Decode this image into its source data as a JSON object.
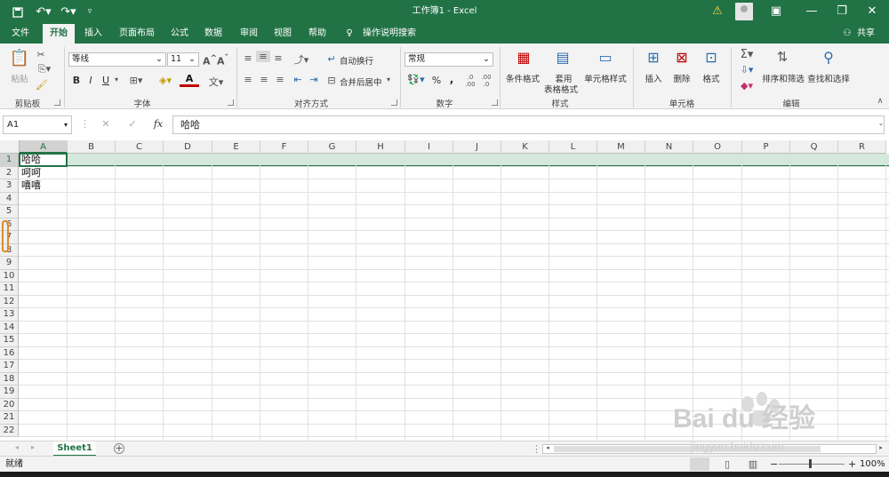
{
  "titlebar": {
    "title": "工作簿1  -  Excel",
    "save_icon": "save-icon",
    "undo_icon": "undo-icon",
    "redo_icon": "redo-icon"
  },
  "tabs": [
    {
      "label": "文件"
    },
    {
      "label": "开始"
    },
    {
      "label": "插入"
    },
    {
      "label": "页面布局"
    },
    {
      "label": "公式"
    },
    {
      "label": "数据"
    },
    {
      "label": "审阅"
    },
    {
      "label": "视图"
    },
    {
      "label": "帮助"
    },
    {
      "label": "操作说明搜索"
    }
  ],
  "share_label": "共享",
  "ribbon": {
    "clipboard": {
      "paste": "粘贴",
      "group": "剪贴板"
    },
    "font": {
      "name": "等线",
      "size": "11",
      "bold": "B",
      "italic": "I",
      "underline": "U",
      "group": "字体"
    },
    "alignment": {
      "wrap": "自动换行",
      "merge": "合并后居中",
      "group": "对齐方式"
    },
    "number": {
      "format": "常规",
      "percent": "%",
      "comma": ",",
      "group": "数字"
    },
    "styles": {
      "cond": "条件格式",
      "table1": "套用",
      "table2": "表格格式",
      "cell": "单元格样式",
      "group": "样式"
    },
    "cells": {
      "insert": "插入",
      "delete": "删除",
      "format": "格式",
      "group": "单元格"
    },
    "editing": {
      "sort": "排序和筛选",
      "find": "查找和选择",
      "group": "编辑"
    }
  },
  "formula_bar": {
    "namebox": "A1",
    "fx": "fx",
    "content": "哈哈"
  },
  "columns": [
    "A",
    "B",
    "C",
    "D",
    "E",
    "F",
    "G",
    "H",
    "I",
    "J",
    "K",
    "L",
    "M",
    "N",
    "O",
    "P",
    "Q",
    "R"
  ],
  "rows": [
    "1",
    "2",
    "3",
    "4",
    "5",
    "6",
    "7",
    "8",
    "9",
    "10",
    "11",
    "12",
    "13",
    "14",
    "15",
    "16",
    "17",
    "18",
    "19",
    "20",
    "21",
    "22"
  ],
  "cells": [
    {
      "ref": "A1",
      "value": "哈哈"
    },
    {
      "ref": "A2",
      "value": "呵呵"
    },
    {
      "ref": "A3",
      "value": "嘻嘻"
    }
  ],
  "sheet": {
    "name": "Sheet1",
    "add": "+"
  },
  "status": {
    "ready": "就绪",
    "zoom": "100%",
    "minus": "−",
    "plus": "+"
  },
  "watermark": {
    "brand": "Bai du 经验",
    "url": "jingyan.baidu.com"
  },
  "accent": "#217346"
}
